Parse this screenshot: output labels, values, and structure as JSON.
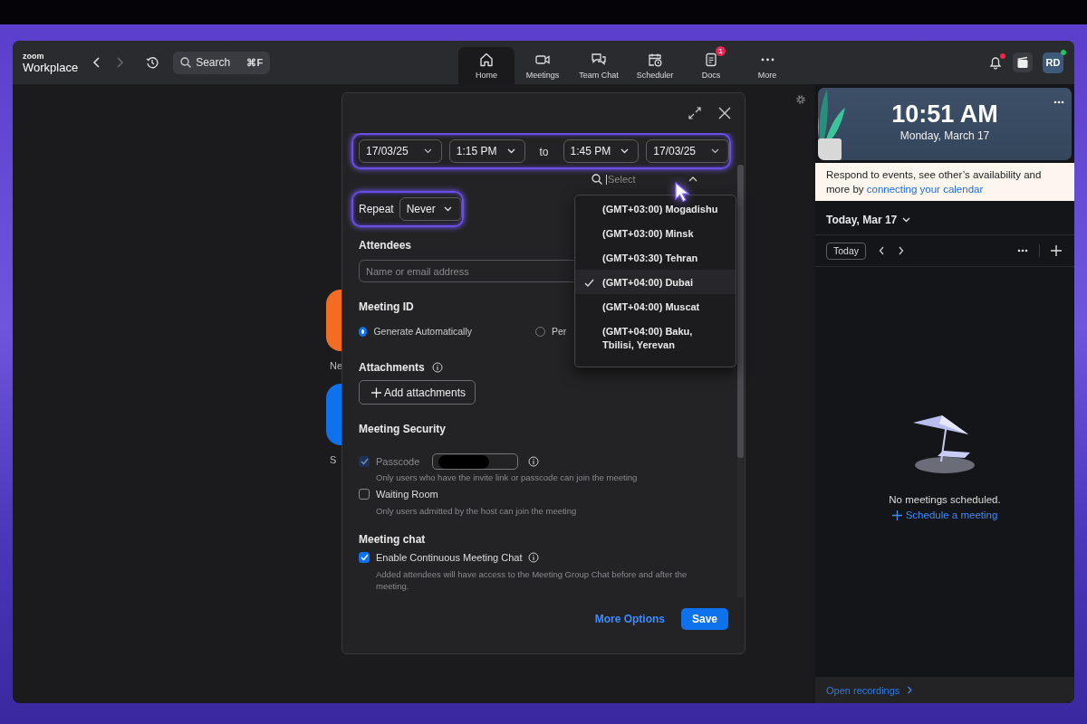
{
  "app": {
    "logo_top": "zoom",
    "logo_bottom": "Workplace",
    "search": {
      "placeholder": "Search",
      "shortcut": "⌘F"
    }
  },
  "nav_tabs": [
    {
      "label": "Home",
      "kind": "home",
      "selected": true
    },
    {
      "label": "Meetings",
      "kind": "video",
      "selected": false
    },
    {
      "label": "Team Chat",
      "kind": "chat",
      "selected": false
    },
    {
      "label": "Scheduler",
      "kind": "calendar",
      "selected": false
    },
    {
      "label": "Docs",
      "kind": "doc",
      "selected": false,
      "badge": "1"
    },
    {
      "label": "More",
      "kind": "more",
      "selected": false
    }
  ],
  "header_right": {
    "unread_notifications": true,
    "avatar": "RD",
    "online": true
  },
  "home_tiles": [
    {
      "label": "Ne",
      "color": "#f26d21"
    },
    {
      "label": "S",
      "color": "#0e72ed"
    }
  ],
  "schedule_dialog": {
    "highlight_date_row": true,
    "start_date": "17/03/25",
    "start_time": "1:15 PM",
    "to": "to",
    "end_time": "1:45 PM",
    "end_date": "17/03/25",
    "timezone_search": {
      "placeholder": "Select"
    },
    "timezones": [
      {
        "label": "(GMT+03:00) Mogadishu",
        "selected": false
      },
      {
        "label": "(GMT+03:00) Minsk",
        "selected": false
      },
      {
        "label": "(GMT+03:30) Tehran",
        "selected": false
      },
      {
        "label": "(GMT+04:00) Dubai",
        "selected": true
      },
      {
        "label": "(GMT+04:00) Muscat",
        "selected": false
      },
      {
        "label": "(GMT+04:00) Baku, Tbilisi, Yerevan",
        "selected": false
      }
    ],
    "highlight_repeat": true,
    "repeat_label": "Repeat",
    "repeat_value": "Never",
    "attendees_label": "Attendees",
    "attendees_placeholder": "Name or email address",
    "meeting_id_label": "Meeting ID",
    "meeting_id_options": [
      {
        "label": "Generate Automatically",
        "selected": true
      },
      {
        "label": "Per",
        "selected": false
      }
    ],
    "attachments_label": "Attachments",
    "add_attachments": "Add attachments",
    "security_label": "Meeting Security",
    "security_options": [
      {
        "kind": "passcode",
        "label": "Passcode",
        "checked": true,
        "disabled": true,
        "hint": "Only users who have the invite link or passcode can join the meeting"
      },
      {
        "kind": "plain",
        "label": "Waiting Room",
        "checked": false,
        "disabled": false,
        "hint": "Only users admitted by the host can join the meeting"
      }
    ],
    "chat_label": "Meeting chat",
    "chat_option": {
      "label": "Enable Continuous Meeting Chat",
      "checked": true,
      "hint": "Added attendees will have access to the Meeting Group Chat before and after the meeting."
    },
    "more_options": "More Options",
    "save": "Save"
  },
  "calendar_panel": {
    "time": "10:51 AM",
    "date": "Monday, March 17",
    "banner_text": "Respond to events, see other’s availability and more by ",
    "banner_link": "connecting your calendar",
    "day_title": "Today, Mar 17",
    "today_button": "Today",
    "empty_text": "No meetings scheduled.",
    "schedule_link": "Schedule a meeting",
    "footer_link": "Open recordings"
  }
}
